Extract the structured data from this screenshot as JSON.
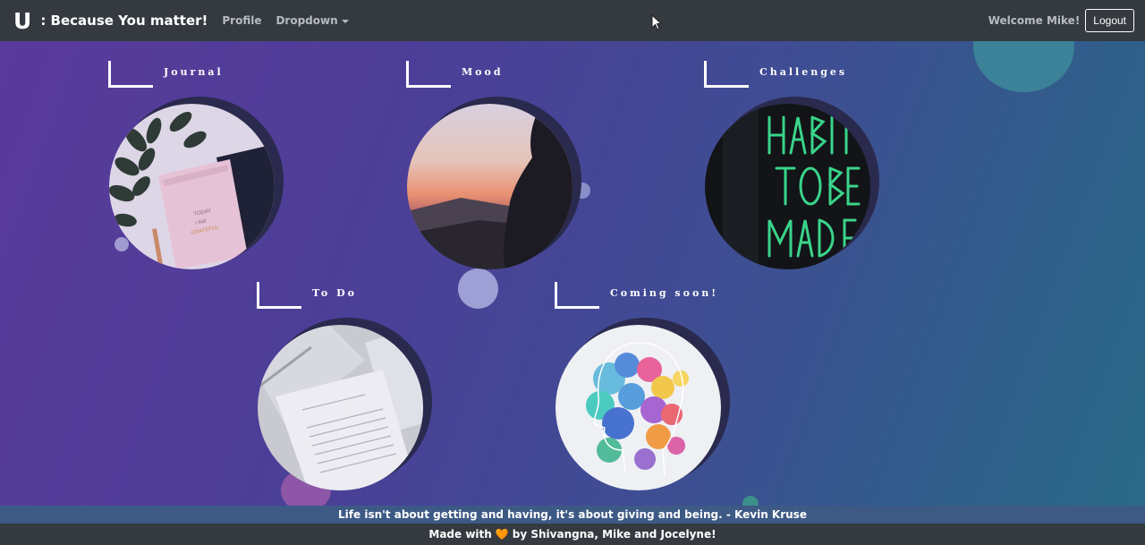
{
  "navbar": {
    "logo": "U",
    "brand": ": Because You matter!",
    "links": [
      {
        "label": "Profile"
      },
      {
        "label": "Dropdown"
      }
    ],
    "welcome": "Welcome Mike!",
    "logout": "Logout"
  },
  "cards": [
    {
      "title": "Journal",
      "image": "journal-notebook-image"
    },
    {
      "title": "Mood",
      "image": "sunset-silhouette-image"
    },
    {
      "title": "Challenges",
      "image": "habits-neon-sign-image"
    },
    {
      "title": "To Do",
      "image": "paper-documents-image"
    },
    {
      "title": "Coming soon!",
      "image": "watercolor-head-image"
    }
  ],
  "quote": "Life isn't about getting and having, it's about giving and being. - Kevin Kruse",
  "footer": {
    "prefix": "Made with",
    "heart_icon": "heart-icon",
    "suffix": "by Shivangna, Mike and Jocelyne!"
  },
  "colors": {
    "navbar_bg": "#343a40",
    "gradient_start": "#5a3a9a",
    "gradient_end": "#2a6a88",
    "quote_bar_bg": "#3d5a85",
    "heart": "#e8801e"
  }
}
